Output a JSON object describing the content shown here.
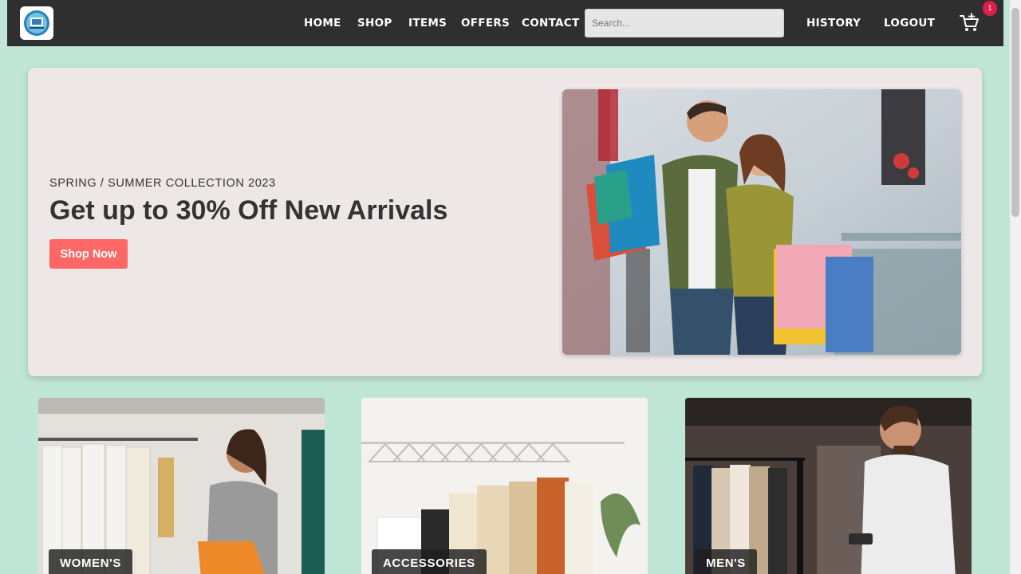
{
  "nav": {
    "links": [
      "HOME",
      "SHOP",
      "ITEMS",
      "OFFERS",
      "CONTACT"
    ],
    "search_placeholder": "Search...",
    "history": "HISTORY",
    "logout": "LOGOUT",
    "cart_count": "1"
  },
  "hero": {
    "subtitle": "SPRING / SUMMER COLLECTION 2023",
    "title": "Get up to 30% Off New Arrivals",
    "button": "Shop Now"
  },
  "categories": [
    {
      "label": "WOMEN'S"
    },
    {
      "label": "ACCESSORIES"
    },
    {
      "label": "MEN'S"
    }
  ],
  "colors": {
    "navbar": "#2f2f2f",
    "page_background": "#bfe6d6",
    "hero_background": "#eee7e7",
    "accent_button": "#ff6666",
    "badge": "#dc1f4a"
  }
}
